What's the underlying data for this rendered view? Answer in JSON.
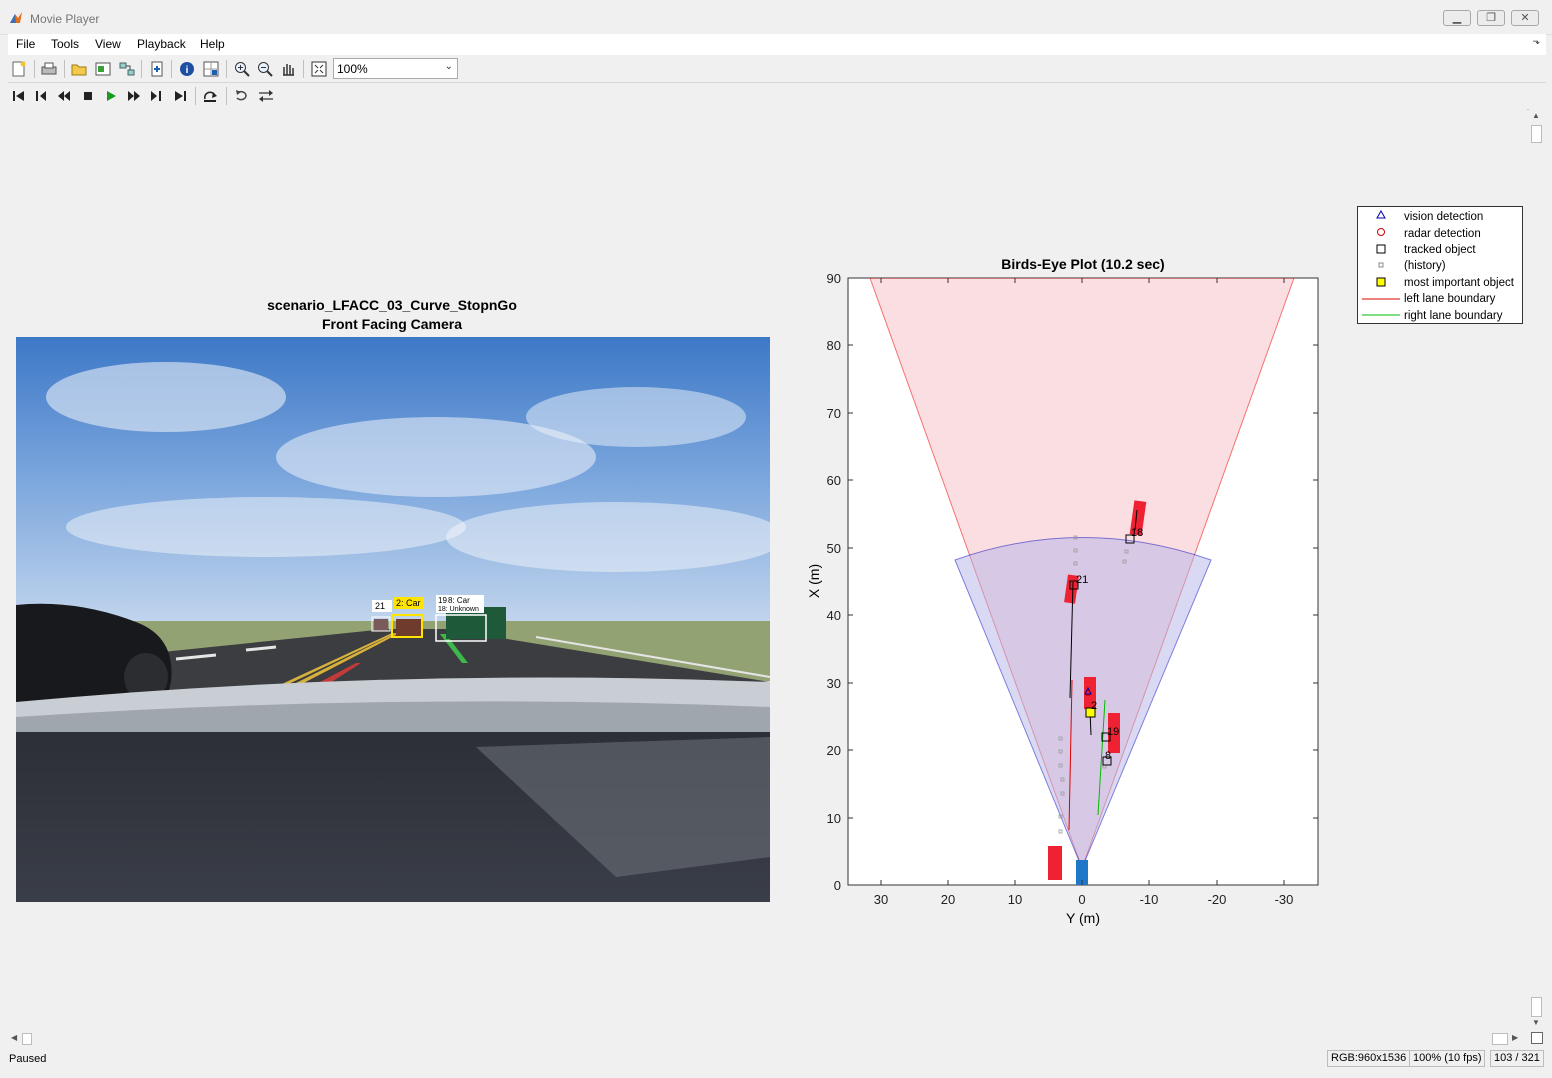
{
  "window": {
    "title": "Movie Player"
  },
  "menu": [
    "File",
    "Tools",
    "View",
    "Playback",
    "Help"
  ],
  "toolbar": {
    "zoom_value": "100%"
  },
  "camera": {
    "title_line1": "scenario_LFACC_03_Curve_StopnGo",
    "title_line2": "Front Facing Camera",
    "labels": [
      "21",
      "2: Car",
      "19",
      "8: Car",
      "18: Unknown"
    ]
  },
  "birds_eye": {
    "title": "Birds-Eye Plot (10.2 sec)",
    "xlabel": "Y (m)",
    "ylabel": "X (m)",
    "x_ticks": [
      "30",
      "20",
      "10",
      "0",
      "-10",
      "-20",
      "-30"
    ],
    "y_ticks": [
      "0",
      "10",
      "20",
      "30",
      "40",
      "50",
      "60",
      "70",
      "80",
      "90"
    ],
    "track_labels": [
      "18",
      "21",
      "2",
      "19",
      "8"
    ],
    "legend": [
      {
        "label": "vision detection",
        "symbol": "triangle",
        "color": "#0000aa"
      },
      {
        "label": "radar detection",
        "symbol": "circle",
        "color": "#cc0000"
      },
      {
        "label": "tracked object",
        "symbol": "square",
        "color": "#000000"
      },
      {
        "label": "(history)",
        "symbol": "small-square",
        "color": "#888888"
      },
      {
        "label": "most important object",
        "symbol": "filled-square",
        "color": "#ffff00"
      },
      {
        "label": "left lane boundary",
        "symbol": "line",
        "color": "#dd0000"
      },
      {
        "label": "right lane boundary",
        "symbol": "line",
        "color": "#00bb00"
      }
    ],
    "colors": {
      "radar_coverage": "#f9c4c9",
      "vision_coverage": "#c9c9f0",
      "vehicle": "#ee2233",
      "ego": "#1f77c8"
    }
  },
  "status": {
    "state": "Paused",
    "resolution": "RGB:960x1536",
    "zoom_fps": "100% (10 fps)",
    "frame": "103 / 321"
  }
}
